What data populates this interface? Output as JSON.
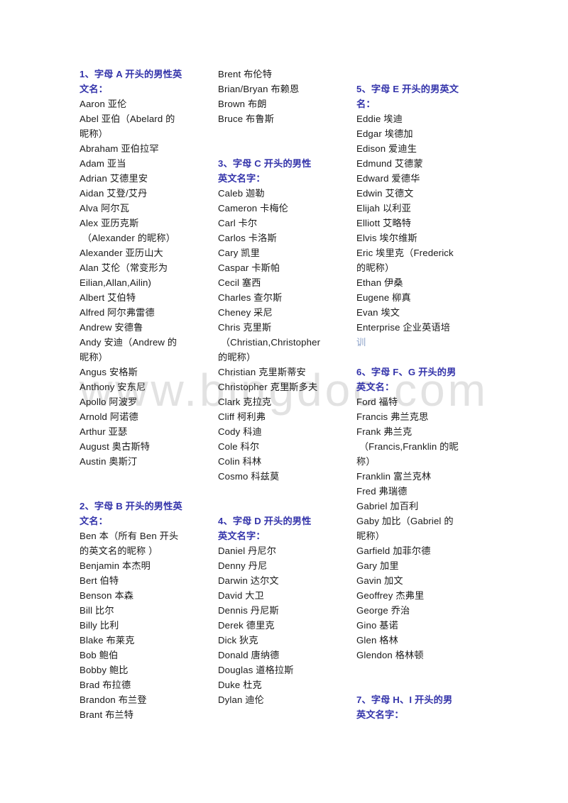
{
  "document": {
    "title": "男性英文名字列表",
    "watermark": "www.bingdoc.com",
    "heading_color": "#3333aa",
    "body_color": "#1a1a1a",
    "link_color": "#8aa0c8",
    "background": "#ffffff"
  },
  "columns": [
    {
      "id": "column-1",
      "lines": [
        {
          "text": "1、字母 A 开头的男性英",
          "style": "heading"
        },
        {
          "text": "文名：",
          "style": "heading"
        },
        {
          "text": "Aaron 亚伦",
          "style": "body"
        },
        {
          "text": "Abel 亚伯（Abelard 的",
          "style": "body"
        },
        {
          "text": "昵称）",
          "style": "body"
        },
        {
          "text": "Abraham 亚伯拉罕",
          "style": "body"
        },
        {
          "text": "Adam 亚当",
          "style": "body"
        },
        {
          "text": "Adrian 艾德里安",
          "style": "body"
        },
        {
          "text": "Aidan 艾登/艾丹",
          "style": "body"
        },
        {
          "text": "Alva 阿尔瓦",
          "style": "body"
        },
        {
          "text": "Alex 亚历克斯",
          "style": "body"
        },
        {
          "text": " （Alexander 的昵称）",
          "style": "body"
        },
        {
          "text": "Alexander 亚历山大",
          "style": "body"
        },
        {
          "text": "Alan 艾伦（常变形为",
          "style": "body"
        },
        {
          "text": "Eilian,Allan,Ailin)",
          "style": "body"
        },
        {
          "text": "Albert 艾伯特",
          "style": "body"
        },
        {
          "text": "Alfred 阿尔弗雷德",
          "style": "body"
        },
        {
          "text": "Andrew 安德鲁",
          "style": "body"
        },
        {
          "text": "Andy 安迪（Andrew 的",
          "style": "body"
        },
        {
          "text": "昵称）",
          "style": "body"
        },
        {
          "text": "Angus 安格斯",
          "style": "body"
        },
        {
          "text": "Anthony 安东尼",
          "style": "body"
        },
        {
          "text": "Apollo 阿波罗",
          "style": "body"
        },
        {
          "text": "Arnold 阿诺德",
          "style": "body"
        },
        {
          "text": "Arthur 亚瑟",
          "style": "body"
        },
        {
          "text": "August 奥古斯特",
          "style": "body"
        },
        {
          "text": "Austin 奥斯汀",
          "style": "body"
        },
        {
          "text": "",
          "style": "blank"
        },
        {
          "text": "",
          "style": "blank"
        },
        {
          "text": "2、字母 B 开头的男性英",
          "style": "heading"
        },
        {
          "text": "文名：",
          "style": "heading"
        },
        {
          "text": "Ben 本（所有 Ben 开头",
          "style": "body"
        },
        {
          "text": "的英文名的昵称 ）",
          "style": "body"
        },
        {
          "text": "Benjamin 本杰明",
          "style": "body"
        },
        {
          "text": "Bert 伯特",
          "style": "body"
        },
        {
          "text": "Benson 本森",
          "style": "body"
        },
        {
          "text": "Bill 比尔",
          "style": "body"
        },
        {
          "text": "Billy 比利",
          "style": "body"
        },
        {
          "text": "Blake 布莱克",
          "style": "body"
        },
        {
          "text": "Bob 鲍伯",
          "style": "body"
        },
        {
          "text": "Bobby 鲍比",
          "style": "body"
        },
        {
          "text": "Brad 布拉德",
          "style": "body"
        },
        {
          "text": "Brandon 布兰登",
          "style": "body"
        },
        {
          "text": "Brant 布兰特",
          "style": "body"
        }
      ]
    },
    {
      "id": "column-2",
      "lines": [
        {
          "text": "Brent 布伦特",
          "style": "body"
        },
        {
          "text": "Brian/Bryan 布赖恩",
          "style": "body"
        },
        {
          "text": "Brown 布朗",
          "style": "body"
        },
        {
          "text": "Bruce 布鲁斯",
          "style": "body"
        },
        {
          "text": "",
          "style": "blank"
        },
        {
          "text": "",
          "style": "blank"
        },
        {
          "text": "3、字母 C 开头的男性",
          "style": "heading"
        },
        {
          "text": "英文名字：",
          "style": "heading"
        },
        {
          "text": "Caleb 迦勒",
          "style": "body"
        },
        {
          "text": "Cameron 卡梅伦",
          "style": "body"
        },
        {
          "text": "Carl 卡尔",
          "style": "body"
        },
        {
          "text": "Carlos 卡洛斯",
          "style": "body"
        },
        {
          "text": "Cary 凯里",
          "style": "body"
        },
        {
          "text": "Caspar 卡斯帕",
          "style": "body"
        },
        {
          "text": "Cecil 塞西",
          "style": "body"
        },
        {
          "text": "Charles 查尔斯",
          "style": "body"
        },
        {
          "text": "Cheney 采尼",
          "style": "body"
        },
        {
          "text": "Chris 克里斯",
          "style": "body"
        },
        {
          "text": " （Christian,Christopher",
          "style": "body"
        },
        {
          "text": "的昵称）",
          "style": "body"
        },
        {
          "text": "Christian 克里斯蒂安",
          "style": "body"
        },
        {
          "text": "Christopher 克里斯多夫",
          "style": "body"
        },
        {
          "text": "Clark 克拉克",
          "style": "body"
        },
        {
          "text": "Cliff 柯利弗",
          "style": "body"
        },
        {
          "text": "Cody 科迪",
          "style": "body"
        },
        {
          "text": "Cole 科尔",
          "style": "body"
        },
        {
          "text": "Colin 科林",
          "style": "body"
        },
        {
          "text": "Cosmo 科兹莫",
          "style": "body"
        },
        {
          "text": "",
          "style": "blank"
        },
        {
          "text": "",
          "style": "blank"
        },
        {
          "text": "4、字母 D 开头的男性",
          "style": "heading"
        },
        {
          "text": "英文名字：",
          "style": "heading"
        },
        {
          "text": "Daniel 丹尼尔",
          "style": "body"
        },
        {
          "text": "Denny 丹尼",
          "style": "body"
        },
        {
          "text": "Darwin 达尔文",
          "style": "body"
        },
        {
          "text": "David 大卫",
          "style": "body"
        },
        {
          "text": "Dennis 丹尼斯",
          "style": "body"
        },
        {
          "text": "Derek 德里克",
          "style": "body"
        },
        {
          "text": "Dick 狄克",
          "style": "body"
        },
        {
          "text": "Donald 唐纳德",
          "style": "body"
        },
        {
          "text": "Douglas 道格拉斯",
          "style": "body"
        },
        {
          "text": "Duke 杜克",
          "style": "body"
        },
        {
          "text": "Dylan 迪伦",
          "style": "body"
        }
      ]
    },
    {
      "id": "column-3",
      "lines": [
        {
          "text": "",
          "style": "blank"
        },
        {
          "text": "5、字母 E 开头的男英文",
          "style": "heading"
        },
        {
          "text": "名：",
          "style": "heading"
        },
        {
          "text": "Eddie 埃迪",
          "style": "body"
        },
        {
          "text": "Edgar 埃德加",
          "style": "body"
        },
        {
          "text": "Edison 爱迪生",
          "style": "body"
        },
        {
          "text": "Edmund 艾德蒙",
          "style": "body"
        },
        {
          "text": "Edward 爱德华",
          "style": "body"
        },
        {
          "text": "Edwin 艾德文",
          "style": "body"
        },
        {
          "text": "Elijah 以利亚",
          "style": "body"
        },
        {
          "text": "Elliott 艾略特",
          "style": "body"
        },
        {
          "text": "Elvis 埃尔维斯",
          "style": "body"
        },
        {
          "text": "Eric 埃里克（Frederick",
          "style": "body"
        },
        {
          "text": "的昵称）",
          "style": "body"
        },
        {
          "text": "Ethan 伊桑",
          "style": "body"
        },
        {
          "text": "Eugene 柳真",
          "style": "body"
        },
        {
          "text": "Evan 埃文",
          "style": "body"
        },
        {
          "text": "Enterprise ",
          "style": "body",
          "suffix": "企业英语培",
          "suffix_style": "muted-cn"
        },
        {
          "text": "训",
          "style": "muted-cn"
        },
        {
          "text": "",
          "style": "blank"
        },
        {
          "text": "6、字母 F、G 开头的男",
          "style": "heading"
        },
        {
          "text": "英文名：",
          "style": "heading"
        },
        {
          "text": "Ford 福特",
          "style": "body"
        },
        {
          "text": "Francis 弗兰克思",
          "style": "body"
        },
        {
          "text": "Frank 弗兰克",
          "style": "body"
        },
        {
          "text": " （Francis,Franklin 的昵",
          "style": "body"
        },
        {
          "text": "称）",
          "style": "body"
        },
        {
          "text": "Franklin 富兰克林",
          "style": "body"
        },
        {
          "text": "Fred 弗瑞德",
          "style": "body"
        },
        {
          "text": "Gabriel 加百利",
          "style": "body"
        },
        {
          "text": "Gaby 加比（Gabriel 的",
          "style": "body"
        },
        {
          "text": "昵称）",
          "style": "body"
        },
        {
          "text": "Garfield 加菲尔德",
          "style": "body"
        },
        {
          "text": "Gary 加里",
          "style": "body"
        },
        {
          "text": "Gavin 加文",
          "style": "body"
        },
        {
          "text": "Geoffrey 杰弗里",
          "style": "body"
        },
        {
          "text": "George 乔治",
          "style": "body"
        },
        {
          "text": "Gino 基诺",
          "style": "body"
        },
        {
          "text": "Glen 格林",
          "style": "body"
        },
        {
          "text": "Glendon 格林顿",
          "style": "body"
        },
        {
          "text": "",
          "style": "blank"
        },
        {
          "text": "",
          "style": "blank"
        },
        {
          "text": "7、字母 H、I 开头的男",
          "style": "heading"
        },
        {
          "text": "英文名字：",
          "style": "heading"
        }
      ]
    }
  ]
}
